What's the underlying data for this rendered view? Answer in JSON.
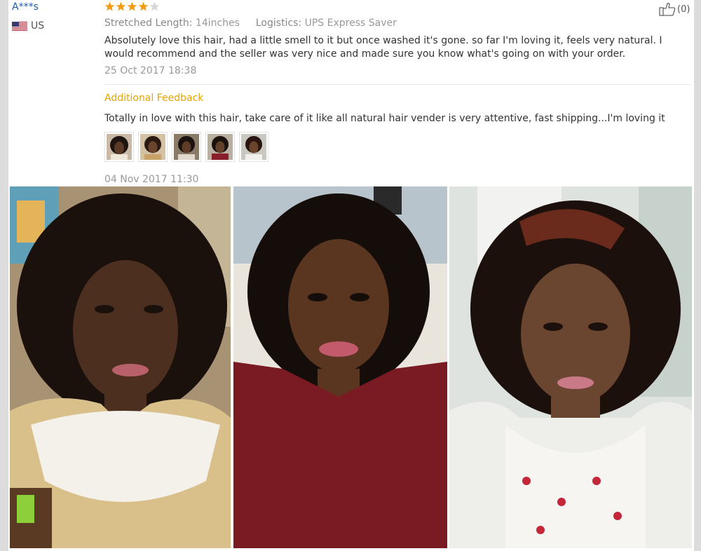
{
  "review": {
    "user_name": "A***s",
    "country": "US",
    "rating": 4,
    "rating_max": 5,
    "attributes": [
      {
        "label": "Stretched Length:",
        "value": "14inches"
      },
      {
        "label": "Logistics:",
        "value": "UPS Express Saver"
      }
    ],
    "helpful_count": "(0)",
    "text": "Absolutely love this hair, had a little smell to it but once washed it's gone. so far I'm loving it, feels very natural. I would recommend and the seller was very nice and made sure you know what's going on with your order.",
    "date": "25 Oct 2017 18:38"
  },
  "additional_feedback": {
    "title": "Additional Feedback",
    "text": "Totally in love with this hair, take care of it like all natural hair vender is very attentive, fast shipping...I'm loving it",
    "date": "04 Nov 2017 11:30",
    "thumbnail_count": 5
  },
  "icons": {
    "star": "star-icon",
    "helpful": "thumbs-up-icon",
    "flag": "us-flag-icon"
  },
  "colors": {
    "star_filled": "#f39c12",
    "star_empty": "#d6d6d6",
    "username": "#1f5ca9",
    "additional_title": "#e8a400",
    "date": "#999999"
  }
}
